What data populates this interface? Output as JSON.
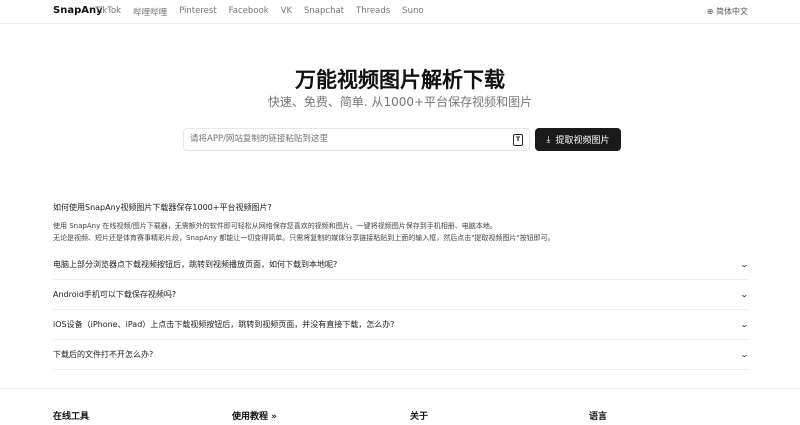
{
  "nav": {
    "brand": "SnapAny",
    "links": [
      "TikTok",
      "哔哩哔哩",
      "Pinterest",
      "Facebook",
      "VK",
      "Snapchat",
      "Threads",
      "Suno"
    ],
    "language": "简体中文",
    "language_icon": "globe-icon"
  },
  "hero": {
    "title": "万能视频图片解析下载",
    "subtitle": "快速、免费、简单. 从1000+平台保存视频和图片",
    "input_placeholder": "请将APP/网站复制的链接粘贴到这里",
    "paste_icon": "clipboard-icon",
    "button_label": "提取视频图片",
    "button_icon": "download-icon"
  },
  "faq": {
    "open": {
      "question": "如何使用SnapAny视频图片下载器保存1000+平台视频图片?",
      "answer_lines": [
        "使用 SnapAny 在线视频/图片下载器，无需额外的软件即可轻松从网络保存您喜欢的视频和图片。一键将视频图片保存到手机相册、电脑本地。",
        "无论是视频、短片还是体育赛事精彩片段，SnapAny 都能让一切变得简单。只需将复制的媒体分享链接粘贴到上面的输入框，然后点击\"提取视频图片\"按钮即可。"
      ]
    },
    "items": [
      "电脑上部分浏览器点下载视频按钮后，跳转到视频播放页面，如何下载到本地呢?",
      "Android手机可以下载保存视频吗?",
      "iOS设备（iPhone、iPad）上点击下载视频按钮后，跳转到视频页面，并没有直接下载，怎么办?",
      "下载后的文件打不开怎么办?"
    ]
  },
  "footer": {
    "headings": [
      "在线工具",
      "使用教程 »",
      "关于",
      "语言"
    ]
  }
}
